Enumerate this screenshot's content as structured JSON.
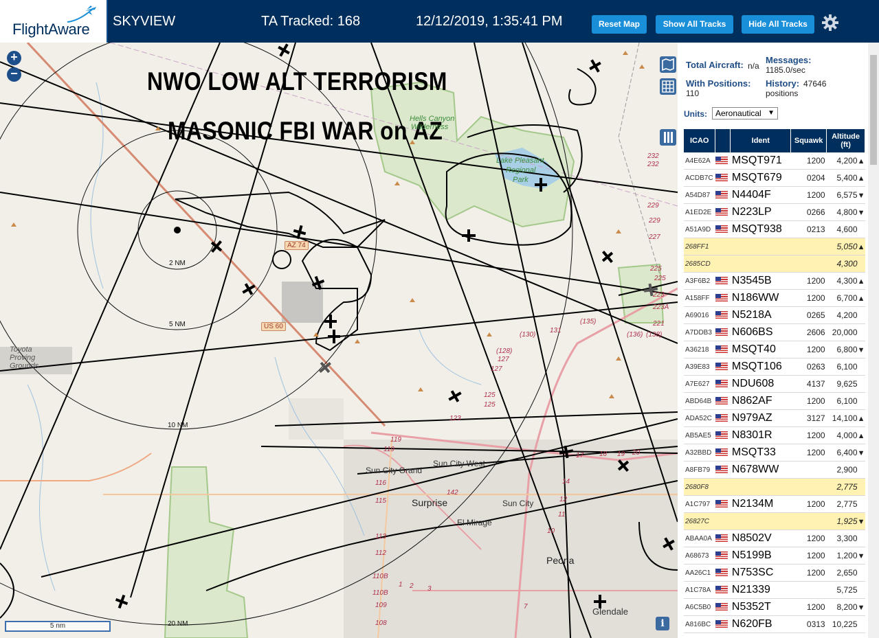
{
  "app": {
    "name": "FlightAware",
    "view": "SKYVIEW"
  },
  "header": {
    "tracked": "TA Tracked: 168",
    "datetime": "12/12/2019, 1:35:41 PM",
    "reset_label": "Reset Map",
    "show_label": "Show All Tracks",
    "hide_label": "Hide All Tracks",
    "accent": "#1a8fd9",
    "bg": "#002f5d"
  },
  "map": {
    "banner_line1": "NWO LOW ALT TERRORISM",
    "banner_line2": "MASONIC FBI WAR on AZ",
    "zoom_in": "+",
    "zoom_out": "−",
    "scale": "5 nm",
    "info": "i",
    "rings": [
      "2 NM",
      "5 NM",
      "10 NM",
      "20 NM"
    ],
    "places": {
      "hells_canyon": "Hells Canyon",
      "hells_canyon_2": "Wilderness",
      "lake_pleasant": "Lake Pleasant",
      "lake_pleasant_2": "Regional",
      "lake_pleasant_3": "Park",
      "toyota": "Toyota",
      "toyota_2": "Proving",
      "toyota_3": "Grounds",
      "sun_city_grand": "Sun City Grand",
      "sun_city_west": "Sun City West",
      "surprise": "Surprise",
      "sun_city": "Sun City",
      "el_mirage": "El Mirage",
      "peoria": "Peoria",
      "glendale": "Glendale"
    },
    "highways": {
      "az74": "AZ 74",
      "us60": "US 60"
    },
    "road_numbers": [
      "232",
      "232",
      "229",
      "229",
      "227",
      "225",
      "225",
      "223",
      "223A",
      "221",
      "(135)",
      "(136)",
      "(138)",
      "131",
      "(130)",
      "(128)",
      "127",
      "127",
      "125",
      "125",
      "123",
      "119",
      "119",
      "116",
      "115",
      "113",
      "112",
      "110B",
      "110B",
      "109",
      "108",
      "142",
      "14",
      "12",
      "11",
      "10",
      "7",
      "2",
      "3",
      "1",
      "20",
      "18",
      "19",
      "17"
    ]
  },
  "panel": {
    "total_label": "Total Aircraft:",
    "total_value": "n/a",
    "positions_label": "With Positions:",
    "positions_value": "110",
    "messages_label": "Messages:",
    "messages_value": "1185.0/sec",
    "history_label": "History:",
    "history_value": "47646",
    "history_unit": "positions",
    "units_label": "Units:",
    "units_value": "Aeronautical",
    "columns": [
      "ICAO",
      "",
      "Ident",
      "Squawk",
      "Altitude (ft)"
    ],
    "rows": [
      {
        "icao": "A4E62A",
        "flag": true,
        "ident": "MSQT971",
        "squawk": "1200",
        "alt": "4,200",
        "trend": "▲",
        "yellow": false
      },
      {
        "icao": "ACDB7C",
        "flag": true,
        "ident": "MSQT679",
        "squawk": "0204",
        "alt": "5,400",
        "trend": "▲",
        "yellow": false
      },
      {
        "icao": "A54D87",
        "flag": true,
        "ident": "N4404F",
        "squawk": "1200",
        "alt": "6,575",
        "trend": "▼",
        "yellow": false
      },
      {
        "icao": "A1ED2E",
        "flag": true,
        "ident": "N223LP",
        "squawk": "0266",
        "alt": "4,800",
        "trend": "▼",
        "yellow": false
      },
      {
        "icao": "A51A9D",
        "flag": true,
        "ident": "MSQT938",
        "squawk": "0213",
        "alt": "4,600",
        "trend": "",
        "yellow": false
      },
      {
        "icao": "268FF1",
        "flag": false,
        "ident": "",
        "squawk": "",
        "alt": "5,050",
        "trend": "▲",
        "yellow": true
      },
      {
        "icao": "2685CD",
        "flag": false,
        "ident": "",
        "squawk": "",
        "alt": "4,300",
        "trend": "",
        "yellow": true
      },
      {
        "icao": "A3F6B2",
        "flag": true,
        "ident": "N3545B",
        "squawk": "1200",
        "alt": "4,300",
        "trend": "▲",
        "yellow": false
      },
      {
        "icao": "A158FF",
        "flag": true,
        "ident": "N186WW",
        "squawk": "1200",
        "alt": "6,700",
        "trend": "▲",
        "yellow": false
      },
      {
        "icao": "A69016",
        "flag": true,
        "ident": "N5218A",
        "squawk": "0265",
        "alt": "4,200",
        "trend": "",
        "yellow": false
      },
      {
        "icao": "A7DDB3",
        "flag": true,
        "ident": "N606BS",
        "squawk": "2606",
        "alt": "20,000",
        "trend": "",
        "yellow": false
      },
      {
        "icao": "A36218",
        "flag": true,
        "ident": "MSQT40",
        "squawk": "1200",
        "alt": "6,800",
        "trend": "▼",
        "yellow": false
      },
      {
        "icao": "A39E83",
        "flag": true,
        "ident": "MSQT106",
        "squawk": "0263",
        "alt": "6,100",
        "trend": "",
        "yellow": false
      },
      {
        "icao": "A7E627",
        "flag": true,
        "ident": "NDU608",
        "squawk": "4137",
        "alt": "9,625",
        "trend": "",
        "yellow": false
      },
      {
        "icao": "ABD64B",
        "flag": true,
        "ident": "N862AF",
        "squawk": "1200",
        "alt": "6,100",
        "trend": "",
        "yellow": false
      },
      {
        "icao": "ADA52C",
        "flag": true,
        "ident": "N979AZ",
        "squawk": "3127",
        "alt": "14,100",
        "trend": "▲",
        "yellow": false
      },
      {
        "icao": "AB5AE5",
        "flag": true,
        "ident": "N8301R",
        "squawk": "1200",
        "alt": "4,000",
        "trend": "▲",
        "yellow": false
      },
      {
        "icao": "A32BBD",
        "flag": true,
        "ident": "MSQT33",
        "squawk": "1200",
        "alt": "6,400",
        "trend": "▼",
        "yellow": false
      },
      {
        "icao": "A8FB79",
        "flag": true,
        "ident": "N678WW",
        "squawk": "",
        "alt": "2,900",
        "trend": "",
        "yellow": false
      },
      {
        "icao": "2680F8",
        "flag": false,
        "ident": "",
        "squawk": "",
        "alt": "2,775",
        "trend": "",
        "yellow": true
      },
      {
        "icao": "A1C797",
        "flag": true,
        "ident": "N2134M",
        "squawk": "1200",
        "alt": "2,775",
        "trend": "",
        "yellow": false
      },
      {
        "icao": "26827C",
        "flag": false,
        "ident": "",
        "squawk": "",
        "alt": "1,925",
        "trend": "▼",
        "yellow": true
      },
      {
        "icao": "ABAA0A",
        "flag": true,
        "ident": "N8502V",
        "squawk": "1200",
        "alt": "3,300",
        "trend": "",
        "yellow": false
      },
      {
        "icao": "A68673",
        "flag": true,
        "ident": "N5199B",
        "squawk": "1200",
        "alt": "1,200",
        "trend": "▼",
        "yellow": false
      },
      {
        "icao": "AA26C1",
        "flag": true,
        "ident": "N753SC",
        "squawk": "1200",
        "alt": "2,650",
        "trend": "",
        "yellow": false
      },
      {
        "icao": "A1C78A",
        "flag": true,
        "ident": "N21339",
        "squawk": "",
        "alt": "5,725",
        "trend": "",
        "yellow": false
      },
      {
        "icao": "A6C5B0",
        "flag": true,
        "ident": "N5352T",
        "squawk": "1200",
        "alt": "8,200",
        "trend": "▼",
        "yellow": false
      },
      {
        "icao": "A816BC",
        "flag": true,
        "ident": "N620FB",
        "squawk": "0313",
        "alt": "10,225",
        "trend": "",
        "yellow": false
      }
    ]
  }
}
